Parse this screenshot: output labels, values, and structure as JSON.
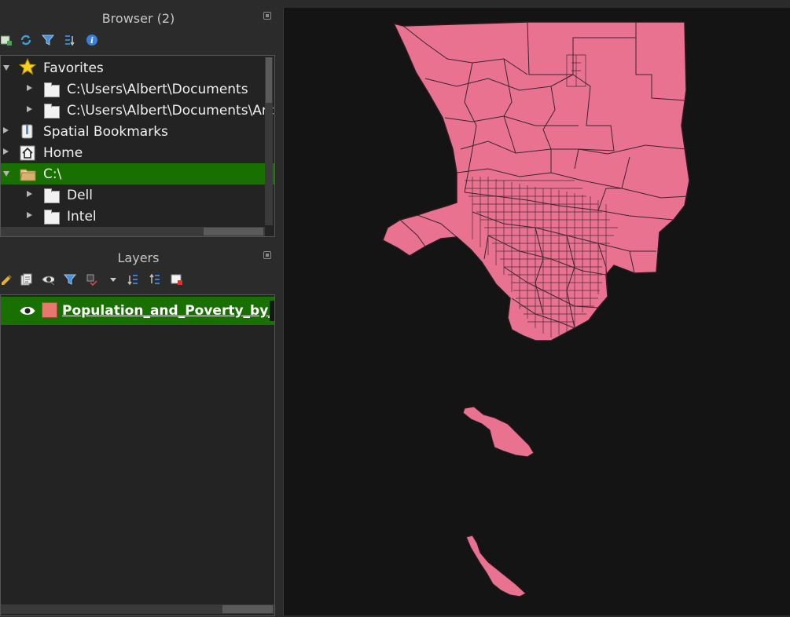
{
  "browser": {
    "title": "Browser (2)",
    "items": [
      {
        "label": "Favorites"
      },
      {
        "label": "C:\\Users\\Albert\\Documents"
      },
      {
        "label": "C:\\Users\\Albert\\Documents\\ArcGIS"
      },
      {
        "label": "Spatial Bookmarks"
      },
      {
        "label": "Home"
      },
      {
        "label": "C:\\"
      },
      {
        "label": "Dell"
      },
      {
        "label": "Intel"
      }
    ]
  },
  "layers": {
    "title": "Layers",
    "items": [
      {
        "label": "Population_and_Poverty_by_Census_Tract"
      }
    ]
  },
  "colors": {
    "selection": "#187000",
    "map_fill": "#e8728f",
    "map_stroke": "#3a2530",
    "map_background": "#141414",
    "layer_symbol": "#e8776c"
  },
  "icons": {
    "toolbar_browser": [
      "add-layer-icon",
      "refresh-icon",
      "filter-icon",
      "collapse-all-icon",
      "properties-icon"
    ],
    "toolbar_layers": [
      "style-icon",
      "add-group-icon",
      "manage-visibility-icon",
      "filter-legend-icon",
      "filter-expression-icon",
      "expand-all-icon",
      "collapse-all-icon",
      "remove-layer-icon"
    ]
  }
}
